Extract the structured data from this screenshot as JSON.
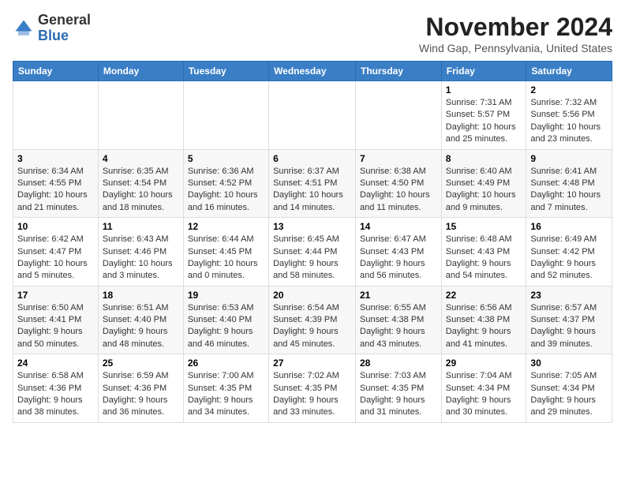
{
  "logo": {
    "general": "General",
    "blue": "Blue"
  },
  "title": "November 2024",
  "location": "Wind Gap, Pennsylvania, United States",
  "days_of_week": [
    "Sunday",
    "Monday",
    "Tuesday",
    "Wednesday",
    "Thursday",
    "Friday",
    "Saturday"
  ],
  "weeks": [
    [
      {
        "day": "",
        "info": ""
      },
      {
        "day": "",
        "info": ""
      },
      {
        "day": "",
        "info": ""
      },
      {
        "day": "",
        "info": ""
      },
      {
        "day": "",
        "info": ""
      },
      {
        "day": "1",
        "info": "Sunrise: 7:31 AM\nSunset: 5:57 PM\nDaylight: 10 hours and 25 minutes."
      },
      {
        "day": "2",
        "info": "Sunrise: 7:32 AM\nSunset: 5:56 PM\nDaylight: 10 hours and 23 minutes."
      }
    ],
    [
      {
        "day": "3",
        "info": "Sunrise: 6:34 AM\nSunset: 4:55 PM\nDaylight: 10 hours and 21 minutes."
      },
      {
        "day": "4",
        "info": "Sunrise: 6:35 AM\nSunset: 4:54 PM\nDaylight: 10 hours and 18 minutes."
      },
      {
        "day": "5",
        "info": "Sunrise: 6:36 AM\nSunset: 4:52 PM\nDaylight: 10 hours and 16 minutes."
      },
      {
        "day": "6",
        "info": "Sunrise: 6:37 AM\nSunset: 4:51 PM\nDaylight: 10 hours and 14 minutes."
      },
      {
        "day": "7",
        "info": "Sunrise: 6:38 AM\nSunset: 4:50 PM\nDaylight: 10 hours and 11 minutes."
      },
      {
        "day": "8",
        "info": "Sunrise: 6:40 AM\nSunset: 4:49 PM\nDaylight: 10 hours and 9 minutes."
      },
      {
        "day": "9",
        "info": "Sunrise: 6:41 AM\nSunset: 4:48 PM\nDaylight: 10 hours and 7 minutes."
      }
    ],
    [
      {
        "day": "10",
        "info": "Sunrise: 6:42 AM\nSunset: 4:47 PM\nDaylight: 10 hours and 5 minutes."
      },
      {
        "day": "11",
        "info": "Sunrise: 6:43 AM\nSunset: 4:46 PM\nDaylight: 10 hours and 3 minutes."
      },
      {
        "day": "12",
        "info": "Sunrise: 6:44 AM\nSunset: 4:45 PM\nDaylight: 10 hours and 0 minutes."
      },
      {
        "day": "13",
        "info": "Sunrise: 6:45 AM\nSunset: 4:44 PM\nDaylight: 9 hours and 58 minutes."
      },
      {
        "day": "14",
        "info": "Sunrise: 6:47 AM\nSunset: 4:43 PM\nDaylight: 9 hours and 56 minutes."
      },
      {
        "day": "15",
        "info": "Sunrise: 6:48 AM\nSunset: 4:43 PM\nDaylight: 9 hours and 54 minutes."
      },
      {
        "day": "16",
        "info": "Sunrise: 6:49 AM\nSunset: 4:42 PM\nDaylight: 9 hours and 52 minutes."
      }
    ],
    [
      {
        "day": "17",
        "info": "Sunrise: 6:50 AM\nSunset: 4:41 PM\nDaylight: 9 hours and 50 minutes."
      },
      {
        "day": "18",
        "info": "Sunrise: 6:51 AM\nSunset: 4:40 PM\nDaylight: 9 hours and 48 minutes."
      },
      {
        "day": "19",
        "info": "Sunrise: 6:53 AM\nSunset: 4:40 PM\nDaylight: 9 hours and 46 minutes."
      },
      {
        "day": "20",
        "info": "Sunrise: 6:54 AM\nSunset: 4:39 PM\nDaylight: 9 hours and 45 minutes."
      },
      {
        "day": "21",
        "info": "Sunrise: 6:55 AM\nSunset: 4:38 PM\nDaylight: 9 hours and 43 minutes."
      },
      {
        "day": "22",
        "info": "Sunrise: 6:56 AM\nSunset: 4:38 PM\nDaylight: 9 hours and 41 minutes."
      },
      {
        "day": "23",
        "info": "Sunrise: 6:57 AM\nSunset: 4:37 PM\nDaylight: 9 hours and 39 minutes."
      }
    ],
    [
      {
        "day": "24",
        "info": "Sunrise: 6:58 AM\nSunset: 4:36 PM\nDaylight: 9 hours and 38 minutes."
      },
      {
        "day": "25",
        "info": "Sunrise: 6:59 AM\nSunset: 4:36 PM\nDaylight: 9 hours and 36 minutes."
      },
      {
        "day": "26",
        "info": "Sunrise: 7:00 AM\nSunset: 4:35 PM\nDaylight: 9 hours and 34 minutes."
      },
      {
        "day": "27",
        "info": "Sunrise: 7:02 AM\nSunset: 4:35 PM\nDaylight: 9 hours and 33 minutes."
      },
      {
        "day": "28",
        "info": "Sunrise: 7:03 AM\nSunset: 4:35 PM\nDaylight: 9 hours and 31 minutes."
      },
      {
        "day": "29",
        "info": "Sunrise: 7:04 AM\nSunset: 4:34 PM\nDaylight: 9 hours and 30 minutes."
      },
      {
        "day": "30",
        "info": "Sunrise: 7:05 AM\nSunset: 4:34 PM\nDaylight: 9 hours and 29 minutes."
      }
    ]
  ]
}
